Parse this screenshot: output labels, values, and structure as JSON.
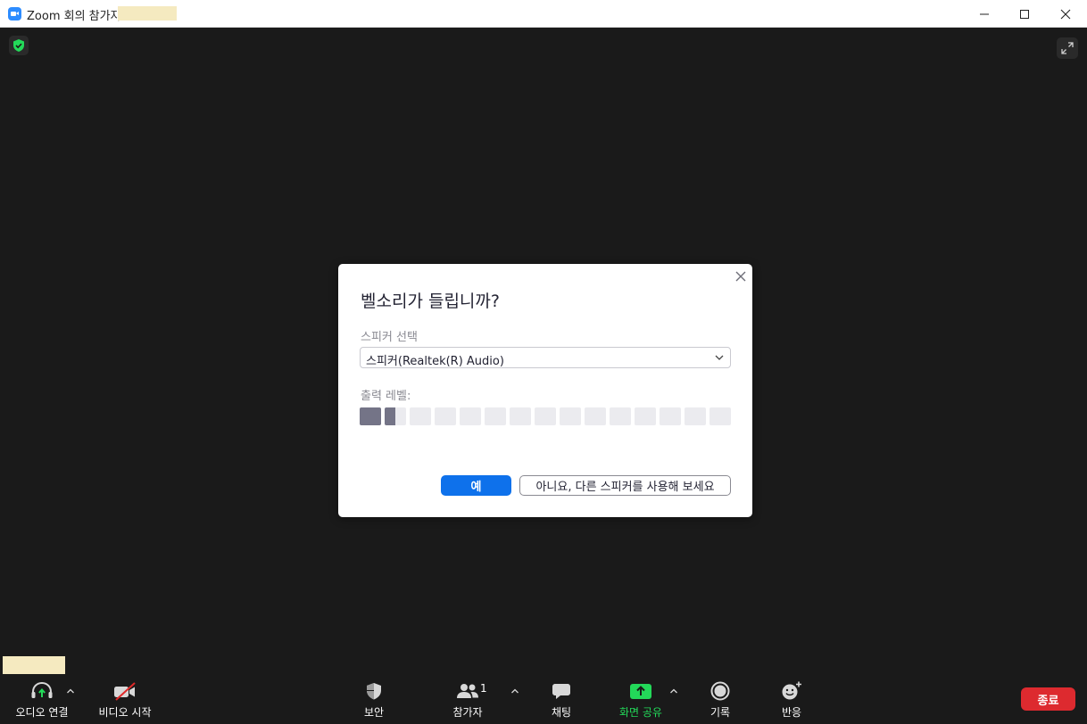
{
  "window": {
    "title": "Zoom 회의 참가자"
  },
  "dialog": {
    "title": "벨소리가 들립니까?",
    "speaker_label": "스피커 선택",
    "speaker_value": "스피커(Realtek(R) Audio)",
    "output_level_label": "출력 레벨:",
    "output_level": 0.1,
    "output_level_segments": 15,
    "yes_label": "예",
    "no_label": "아니요, 다른 스피커를 사용해 보세요"
  },
  "toolbar": {
    "audio_label": "오디오 연결",
    "video_label": "비디오 시작",
    "security_label": "보안",
    "participants_label": "참가자",
    "participants_count": "1",
    "chat_label": "채팅",
    "share_label": "화면 공유",
    "record_label": "기록",
    "reactions_label": "반응",
    "end_label": "종료"
  },
  "colors": {
    "accent_blue": "#0e71eb",
    "share_green": "#23d959",
    "end_red": "#dd2a2f",
    "level_fill": "#747487",
    "level_empty": "#ebebef"
  },
  "icons": {
    "app": "zoom-logo-icon",
    "security_badge": "shield-check-icon",
    "fullscreen": "expand-icon",
    "audio": "headphones-icon",
    "video": "video-off-icon",
    "security": "shield-icon",
    "participants": "people-icon",
    "chat": "chat-bubble-icon",
    "share": "share-screen-icon",
    "record": "record-icon",
    "reactions": "emoji-add-icon"
  }
}
